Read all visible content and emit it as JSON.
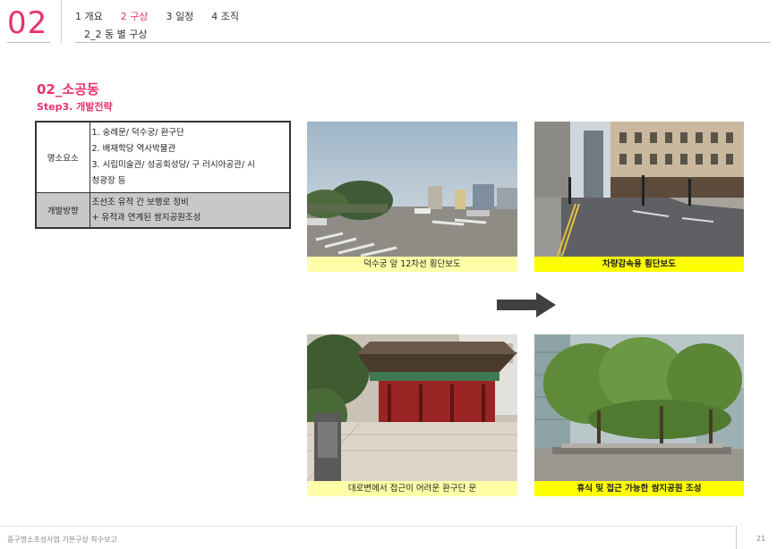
{
  "header": {
    "chapter_num": "02",
    "tabs": [
      {
        "label": "1 개요",
        "active": false
      },
      {
        "label": "2 구상",
        "active": true
      },
      {
        "label": "3 일정",
        "active": false
      },
      {
        "label": "4 조직",
        "active": false
      }
    ],
    "subtitle": "2_2 동 별 구상",
    "accent_color": "#e8336e"
  },
  "section": {
    "title": "02_소공동",
    "subtitle": "Step3. 개발전략"
  },
  "table": {
    "row1_header": "명소요소",
    "row1_lines": [
      "1. 숭례문/ 덕수궁/ 환구단",
      "2. 배재학당 역사박물관",
      "3. 시립미술관/ 성공회성당/ 구 러시아공관/ 시",
      "청광장 등"
    ],
    "row2_header": "개발방향",
    "row2_lines": [
      "조선조 유적 간 보행로 정비",
      "+ 유적과 연계된 쌈지공원조성"
    ]
  },
  "photos": {
    "p1_caption": "덕수궁 앞 12차선 횡단보도",
    "p2_caption": "차량감속용 횡단보도",
    "p3_caption": "대로변에서 접근이 어려운 환구단 문",
    "p4_caption": "휴식 및  접근 가능한 쌈지공원 조성"
  },
  "footer": {
    "doc_title": "중구명소조성사업 기본구상 착수보고",
    "page": "21"
  }
}
